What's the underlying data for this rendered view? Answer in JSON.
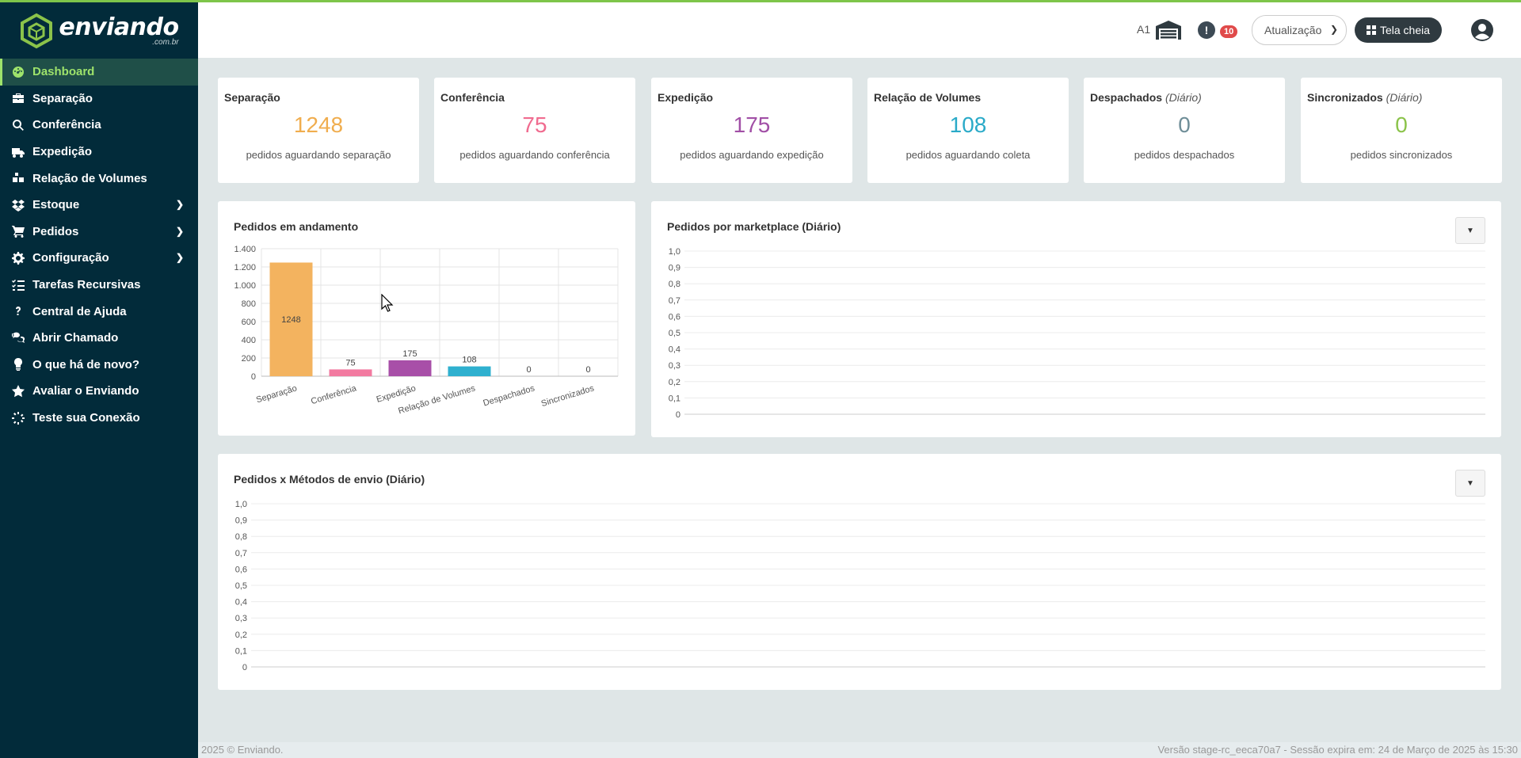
{
  "brand": {
    "name": "enviando",
    "suffix": ".com.br"
  },
  "sidebar": {
    "items": [
      {
        "label": "Dashboard",
        "icon": "dashboard-icon",
        "active": true
      },
      {
        "label": "Separação",
        "icon": "briefcase-icon"
      },
      {
        "label": "Conferência",
        "icon": "search-icon"
      },
      {
        "label": "Expedição",
        "icon": "truck-icon"
      },
      {
        "label": "Relação de Volumes",
        "icon": "boxes-icon"
      },
      {
        "label": "Estoque",
        "icon": "dropbox-icon",
        "submenu": true
      },
      {
        "label": "Pedidos",
        "icon": "cart-icon",
        "submenu": true
      },
      {
        "label": "Configuração",
        "icon": "gear-icon",
        "submenu": true
      },
      {
        "label": "Tarefas Recursivas",
        "icon": "tasks-icon"
      },
      {
        "label": "Central de Ajuda",
        "icon": "question-icon"
      },
      {
        "label": "Abrir Chamado",
        "icon": "chat-icon"
      },
      {
        "label": "O que há de novo?",
        "icon": "lightbulb-icon"
      },
      {
        "label": "Avaliar o Enviando",
        "icon": "star-icon"
      },
      {
        "label": "Teste sua Conexão",
        "icon": "spinner-icon"
      }
    ]
  },
  "header": {
    "warehouse_code": "A1",
    "alert_count": "10",
    "update_select": "Atualização",
    "fullscreen_label": "Tela cheia"
  },
  "stats": [
    {
      "title": "Separação",
      "qualifier": "",
      "value": "1248",
      "desc": "pedidos aguardando separação",
      "color": "#f0ad4e"
    },
    {
      "title": "Conferência",
      "qualifier": "",
      "value": "75",
      "desc": "pedidos aguardando conferência",
      "color": "#f06b8f"
    },
    {
      "title": "Expedição",
      "qualifier": "",
      "value": "175",
      "desc": "pedidos aguardando expedição",
      "color": "#a14fa6"
    },
    {
      "title": "Relação de Volumes",
      "qualifier": "",
      "value": "108",
      "desc": "pedidos aguardando coleta",
      "color": "#2aaac8"
    },
    {
      "title": "Despachados",
      "qualifier": "(Diário)",
      "value": "0",
      "desc": "pedidos despachados",
      "color": "#6f8e98"
    },
    {
      "title": "Sincronizados",
      "qualifier": "(Diário)",
      "value": "0",
      "desc": "pedidos sincronizados",
      "color": "#8bc34a"
    }
  ],
  "panels": {
    "in_progress": {
      "title": "Pedidos em andamento"
    },
    "marketplace": {
      "title": "Pedidos por marketplace (Diário)"
    },
    "shipping": {
      "title": "Pedidos x Métodos de envio (Diário)"
    }
  },
  "chart_data": [
    {
      "type": "bar",
      "title": "Pedidos em andamento",
      "categories": [
        "Separação",
        "Conferência",
        "Expedição",
        "Relação de Volumes",
        "Despachados",
        "Sincronizados"
      ],
      "values": [
        1248,
        75,
        175,
        108,
        0,
        0
      ],
      "colors": [
        "#f3b35f",
        "#f27aa0",
        "#a84fa8",
        "#2fb0cf",
        "#6f8e98",
        "#8bc34a"
      ],
      "y_ticks": [
        "0",
        "200",
        "400",
        "600",
        "800",
        "1.000",
        "1.200",
        "1.400"
      ],
      "ylim": [
        0,
        1400
      ],
      "grid": true,
      "xlabel": "",
      "ylabel": ""
    },
    {
      "type": "line",
      "title": "Pedidos por marketplace (Diário)",
      "series": [],
      "y_ticks": [
        "0",
        "0,1",
        "0,2",
        "0,3",
        "0,4",
        "0,5",
        "0,6",
        "0,7",
        "0,8",
        "0,9",
        "1,0"
      ],
      "ylim": [
        0,
        1
      ],
      "grid": true
    },
    {
      "type": "line",
      "title": "Pedidos x Métodos de envio (Diário)",
      "series": [],
      "y_ticks": [
        "0",
        "0,1",
        "0,2",
        "0,3",
        "0,4",
        "0,5",
        "0,6",
        "0,7",
        "0,8",
        "0,9",
        "1,0"
      ],
      "ylim": [
        0,
        1
      ],
      "grid": true
    }
  ],
  "footer": {
    "copyright": "2025 © Enviando.",
    "version": "Versão stage-rc_eeca70a7 - Sessão expira em: 24 de Março de 2025 às 15:30"
  }
}
